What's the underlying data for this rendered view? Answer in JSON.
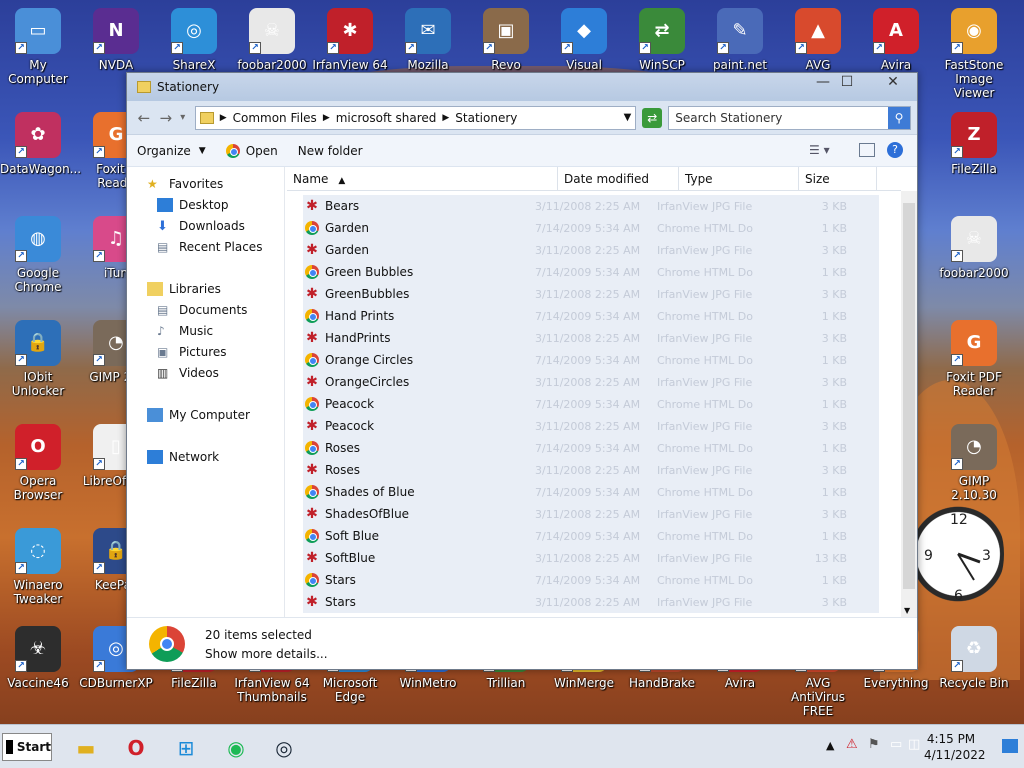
{
  "desktop": {
    "icons": [
      {
        "label": "My Computer",
        "color": "#4a8fd8",
        "glyph": "▭"
      },
      {
        "label": "NVDA",
        "color": "#5a2d91",
        "glyph": "N"
      },
      {
        "label": "ShareX",
        "color": "#2d8fd8",
        "glyph": "◎"
      },
      {
        "label": "foobar2000",
        "color": "#e8e8e8",
        "glyph": "☠"
      },
      {
        "label": "IrfanView 64",
        "color": "#c0202a",
        "glyph": "✱"
      },
      {
        "label": "Mozilla",
        "color": "#2d6fb8",
        "glyph": "✉"
      },
      {
        "label": "Revo",
        "color": "#8a6a4a",
        "glyph": "▣"
      },
      {
        "label": "Visual Studio",
        "color": "#2d7ed8",
        "glyph": "◆"
      },
      {
        "label": "WinSCP",
        "color": "#3a8a3a",
        "glyph": "⇄"
      },
      {
        "label": "paint.net",
        "color": "#4a6ab8",
        "glyph": "✎"
      },
      {
        "label": "AVG AntiVirus",
        "color": "#d84a2d",
        "glyph": "▲"
      },
      {
        "label": "Avira",
        "color": "#d0202a",
        "glyph": "A"
      },
      {
        "label": "FastStone Image Viewer",
        "color": "#e8a02d",
        "glyph": "◉"
      },
      {
        "label": "DataWagon...",
        "color": "#c03060",
        "glyph": "✿"
      },
      {
        "label": "Foxit P Reade",
        "color": "#e8702d",
        "glyph": "G"
      },
      {
        "label": "FileZilla",
        "color": "#c0202a",
        "glyph": "Z"
      },
      {
        "label": "Google Chrome",
        "color": "#3a8ad8",
        "glyph": "◍"
      },
      {
        "label": "iTun",
        "color": "#d84a8a",
        "glyph": "♫"
      },
      {
        "label": "foobar2000",
        "color": "#e8e8e8",
        "glyph": "☠"
      },
      {
        "label": "IObit Unlocker",
        "color": "#2d6fb8",
        "glyph": "🔒"
      },
      {
        "label": "GIMP 2.1",
        "color": "#7a6a5a",
        "glyph": "◔"
      },
      {
        "label": "Foxit PDF Reader",
        "color": "#e8702d",
        "glyph": "G"
      },
      {
        "label": "Opera Browser",
        "color": "#d0202a",
        "glyph": "O"
      },
      {
        "label": "LibreOf 7.3",
        "color": "#f0f0f0",
        "glyph": "▯"
      },
      {
        "label": "GIMP 2.10.30",
        "color": "#7a6a5a",
        "glyph": "◔"
      },
      {
        "label": "Winaero Tweaker",
        "color": "#3a9ad8",
        "glyph": "◌"
      },
      {
        "label": "KeePas",
        "color": "#2d4a8a",
        "glyph": "🔒"
      },
      {
        "label": "Vaccine46",
        "color": "#2d2d2d",
        "glyph": "☣"
      },
      {
        "label": "CDBurnerXP",
        "color": "#3a7ad8",
        "glyph": "◎"
      },
      {
        "label": "FileZilla",
        "color": "#c0202a",
        "glyph": "Z"
      },
      {
        "label": "IrfanView 64 Thumbnails",
        "color": "#c0202a",
        "glyph": "✱"
      },
      {
        "label": "Microsoft Edge",
        "color": "#2d8ad8",
        "glyph": "e"
      },
      {
        "label": "WinMetro",
        "color": "#2d6fd8",
        "glyph": "▦"
      },
      {
        "label": "Trillian",
        "color": "#3a8a3a",
        "glyph": "◐"
      },
      {
        "label": "WinMerge",
        "color": "#e8c02d",
        "glyph": "≡"
      },
      {
        "label": "HandBrake",
        "color": "#c04a2d",
        "glyph": "☕"
      },
      {
        "label": "Avira",
        "color": "#d0202a",
        "glyph": "A"
      },
      {
        "label": "AVG AntiVirus FREE",
        "color": "#d84a2d",
        "glyph": "▲"
      },
      {
        "label": "Everything",
        "color": "#e87a2d",
        "glyph": "🔍"
      },
      {
        "label": "Recycle Bin",
        "color": "#cfd8e4",
        "glyph": "♻"
      }
    ],
    "partial_labels": [
      "sX",
      "XP",
      "ies",
      "I"
    ]
  },
  "window": {
    "title": "Stationery",
    "breadcrumb": [
      "Common Files",
      "microsoft shared",
      "Stationery"
    ],
    "search_placeholder": "Search Stationery",
    "toolbar": {
      "organize": "Organize",
      "open": "Open",
      "new_folder": "New folder"
    },
    "nav": {
      "favorites": "Favorites",
      "desktop": "Desktop",
      "downloads": "Downloads",
      "recent": "Recent Places",
      "libraries": "Libraries",
      "documents": "Documents",
      "music": "Music",
      "pictures": "Pictures",
      "videos": "Videos",
      "computer": "My Computer",
      "network": "Network"
    },
    "columns": {
      "name": "Name",
      "date": "Date modified",
      "type": "Type",
      "size": "Size"
    },
    "files": [
      {
        "name": "Bears",
        "kind": "irfan",
        "date": "3/11/2008 2:25 AM",
        "type": "IrfanView JPG File",
        "size": "3 KB"
      },
      {
        "name": "Garden",
        "kind": "chrome",
        "date": "7/14/2009 5:34 AM",
        "type": "Chrome HTML Do",
        "size": "1 KB"
      },
      {
        "name": "Garden",
        "kind": "irfan",
        "date": "3/11/2008 2:25 AM",
        "type": "IrfanView JPG File",
        "size": "3 KB"
      },
      {
        "name": "Green Bubbles",
        "kind": "chrome",
        "date": "7/14/2009 5:34 AM",
        "type": "Chrome HTML Do",
        "size": "1 KB"
      },
      {
        "name": "GreenBubbles",
        "kind": "irfan",
        "date": "3/11/2008 2:25 AM",
        "type": "IrfanView JPG File",
        "size": "3 KB"
      },
      {
        "name": "Hand Prints",
        "kind": "chrome",
        "date": "7/14/2009 5:34 AM",
        "type": "Chrome HTML Do",
        "size": "1 KB"
      },
      {
        "name": "HandPrints",
        "kind": "irfan",
        "date": "3/11/2008 2:25 AM",
        "type": "IrfanView JPG File",
        "size": "3 KB"
      },
      {
        "name": "Orange Circles",
        "kind": "chrome",
        "date": "7/14/2009 5:34 AM",
        "type": "Chrome HTML Do",
        "size": "1 KB"
      },
      {
        "name": "OrangeCircles",
        "kind": "irfan",
        "date": "3/11/2008 2:25 AM",
        "type": "IrfanView JPG File",
        "size": "3 KB"
      },
      {
        "name": "Peacock",
        "kind": "chrome",
        "date": "7/14/2009 5:34 AM",
        "type": "Chrome HTML Do",
        "size": "1 KB"
      },
      {
        "name": "Peacock",
        "kind": "irfan",
        "date": "3/11/2008 2:25 AM",
        "type": "IrfanView JPG File",
        "size": "3 KB"
      },
      {
        "name": "Roses",
        "kind": "chrome",
        "date": "7/14/2009 5:34 AM",
        "type": "Chrome HTML Do",
        "size": "1 KB"
      },
      {
        "name": "Roses",
        "kind": "irfan",
        "date": "3/11/2008 2:25 AM",
        "type": "IrfanView JPG File",
        "size": "3 KB"
      },
      {
        "name": "Shades of Blue",
        "kind": "chrome",
        "date": "7/14/2009 5:34 AM",
        "type": "Chrome HTML Do",
        "size": "1 KB"
      },
      {
        "name": "ShadesOfBlue",
        "kind": "irfan",
        "date": "3/11/2008 2:25 AM",
        "type": "IrfanView JPG File",
        "size": "3 KB"
      },
      {
        "name": "Soft Blue",
        "kind": "chrome",
        "date": "7/14/2009 5:34 AM",
        "type": "Chrome HTML Do",
        "size": "1 KB"
      },
      {
        "name": "SoftBlue",
        "kind": "irfan",
        "date": "3/11/2008 2:25 AM",
        "type": "IrfanView JPG File",
        "size": "13 KB"
      },
      {
        "name": "Stars",
        "kind": "chrome",
        "date": "7/14/2009 5:34 AM",
        "type": "Chrome HTML Do",
        "size": "1 KB"
      },
      {
        "name": "Stars",
        "kind": "irfan",
        "date": "3/11/2008 2:25 AM",
        "type": "IrfanView JPG File",
        "size": "3 KB"
      }
    ],
    "status": {
      "count": "20 items selected",
      "details": "Show more details..."
    }
  },
  "taskbar": {
    "start": "Start",
    "time": "4:15 PM",
    "date": "4/11/2022"
  }
}
